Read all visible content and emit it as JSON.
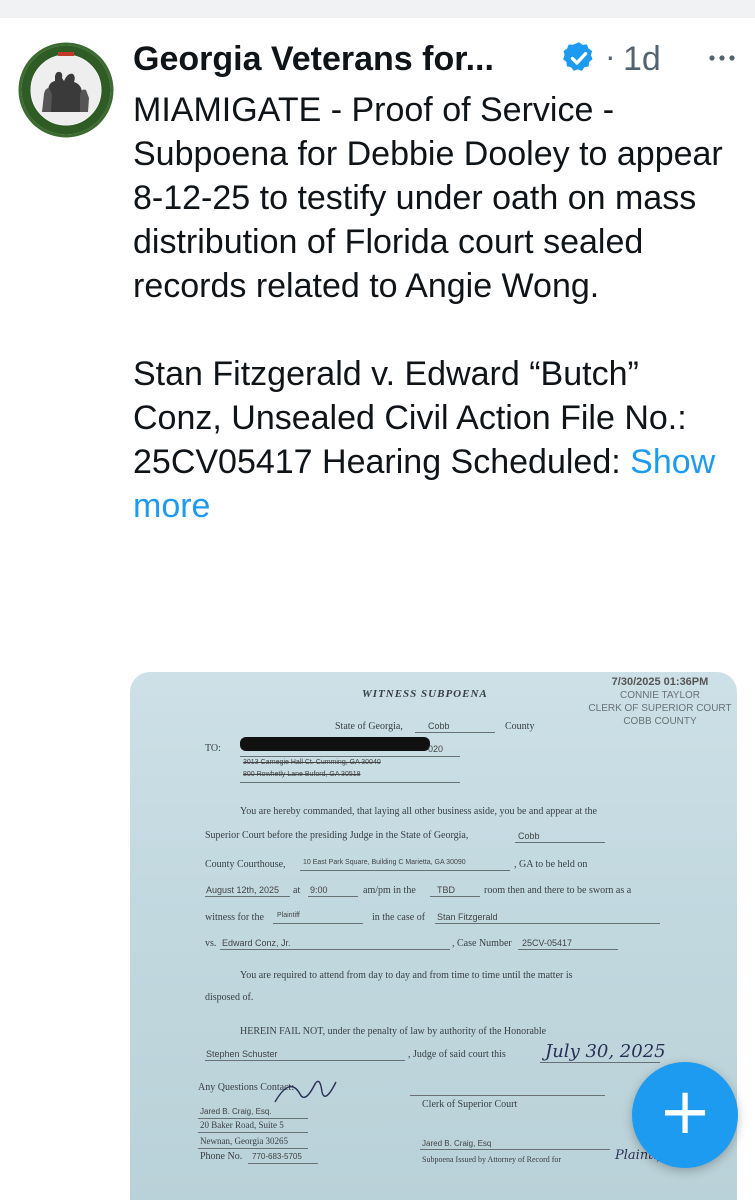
{
  "post": {
    "author_name": "Georgia Veterans for...",
    "time": "1d",
    "separator": "·",
    "paragraph1": "MIAMIGATE - Proof of Service - Subpoena for Debbie Dooley to appear 8-12-25 to testify under oath on mass distribution of Florida court sealed records related to Angie Wong.",
    "paragraph2": "Stan Fitzgerald v. Edward “Butch” Conz, Unsealed Civil Action File No.: 25CV05417 Hearing Scheduled:",
    "show_more": "Show more"
  },
  "document": {
    "stamp_date": "7/30/2025 01:36PM",
    "stamp_clerk": "CONNIE TAYLOR",
    "stamp_title": "CLERK OF SUPERIOR COURT",
    "stamp_county": "COBB COUNTY",
    "title": "WITNESS SUBPOENA",
    "state_label": "State of Georgia,",
    "state_county": "Cobb",
    "county_label": "County",
    "to_label": "TO:",
    "to_suffix": "020",
    "addr1": "3013 Carnegie Hall Ct. Cumming, GA 30040",
    "addr2": "800 Rowhetly Lane Buford, GA 30518",
    "para1": "You are hereby commanded, that laying all other business aside, you be and appear at the",
    "para2_a": "Superior Court before the presiding Judge in the State of Georgia,",
    "para2_county": "Cobb",
    "courthouse_prefix": "County Courthouse,",
    "courthouse_addr": "10 East Park Square, Building C Marietta, GA 30090",
    "held_on": ", GA to be held on",
    "date_value": "August 12th, 2025",
    "at_label": "at",
    "time_value": "9:00",
    "ampm_label": "am/pm in the",
    "room_value": "TBD",
    "room_text": "room then and there to be sworn as a",
    "witness_for": "witness for the",
    "party_value": "Plaintiff",
    "case_of": "in the case of",
    "plaintiff_value": "Stan Fitzgerald",
    "vs_label": "vs.",
    "defendant_value": "Edward Conz, Jr.",
    "case_number_label": ", Case Number",
    "case_number": "25CV-05417",
    "attend1": "You are required to attend from day to day and from time to time until the matter is",
    "attend2": "disposed of.",
    "herein": "HEREIN FAIL NOT, under the penalty of law by authority of the Honorable",
    "judge_value": "Stephen Schuster",
    "judge_label": ", Judge of said court this",
    "sign_date": "July 30, 2025",
    "questions": "Any Questions Contact:",
    "contact_name": "Jared B. Craig, Esq.",
    "contact_addr1": "20 Baker Road, Suite 5",
    "contact_addr2": "Newnan, Georgia 30265",
    "phone_label": "Phone No.",
    "phone_value": "770-683-5705",
    "clerk_label": "Clerk of Superior Court",
    "attorney_value": "Jared B. Craig, Esq",
    "issued_label": "Subpoena Issued by Attorney of Record for",
    "issued_value": "Plaintiff"
  },
  "fab": {
    "label": "+"
  },
  "colors": {
    "accent": "#1d9bf0",
    "text": "#0f1419",
    "muted": "#536471"
  },
  "icons": {
    "verified": "verified-badge-icon",
    "more": "more-horizontal-icon",
    "fab": "compose-plus-icon"
  }
}
